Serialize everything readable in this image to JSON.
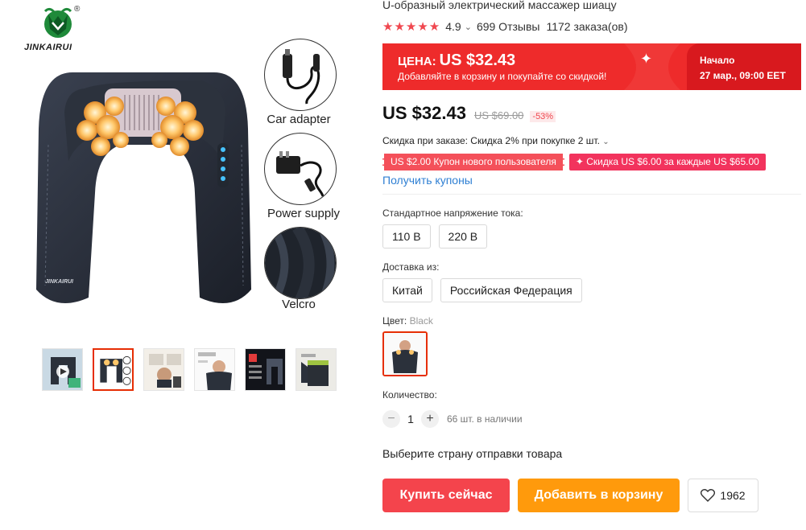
{
  "brand": {
    "name": "JINKAIRUI",
    "registered": "®"
  },
  "gallery": {
    "accessories": [
      {
        "label": "Car adapter",
        "icon": "car-adapter-icon"
      },
      {
        "label": "Power supply",
        "icon": "power-supply-icon"
      },
      {
        "label": "Velcro",
        "icon": "velcro-strap-icon"
      }
    ],
    "device_label": "JINKAIRUI",
    "thumbnails": 6,
    "active_thumbnail": 2
  },
  "product": {
    "title": "U-образный электрический массажер шиацу",
    "rating": "4.9",
    "reviews": "699 Отзывы",
    "orders": "1172 заказа(ов)"
  },
  "promo": {
    "price_label": "ЦЕНА:",
    "price": "US $32.43",
    "subtitle": "Добавляйте в корзину и покупайте со скидкой!",
    "start_label": "Начало",
    "start_time": "27 мар., 09:00 EET",
    "colors": {
      "banner": "#ee2b2b",
      "banner_right": "#d8191e"
    }
  },
  "pricing": {
    "current": "US $32.43",
    "old": "US $69.00",
    "discount": "-53%",
    "order_discount": "Скидка при заказе: Скидка 2% при покупке 2 шт.",
    "coupons": [
      "US $2.00 Купон нового пользователя",
      "✦ Скидка US $6.00 за каждые US $65.00"
    ],
    "get_coupons": "Получить купоны"
  },
  "voltage": {
    "label": "Стандартное напряжение тока:",
    "options": [
      "110 В",
      "220 В"
    ]
  },
  "shipping": {
    "label": "Доставка из:",
    "options": [
      "Китай",
      "Российская Федерация"
    ]
  },
  "color": {
    "label": "Цвет:",
    "selected": "Black"
  },
  "quantity": {
    "label": "Количество:",
    "minus": "−",
    "value": "1",
    "plus": "+",
    "stock": "66 шт. в наличии"
  },
  "ship_prompt": "Выберите страну отправки товара",
  "actions": {
    "buy": "Купить сейчас",
    "cart": "Добавить в корзину",
    "wishlist_count": "1962"
  },
  "accent_colors": {
    "primary_red": "#f4444c",
    "orange": "#ff9a0c",
    "link": "#2e7fd3"
  }
}
